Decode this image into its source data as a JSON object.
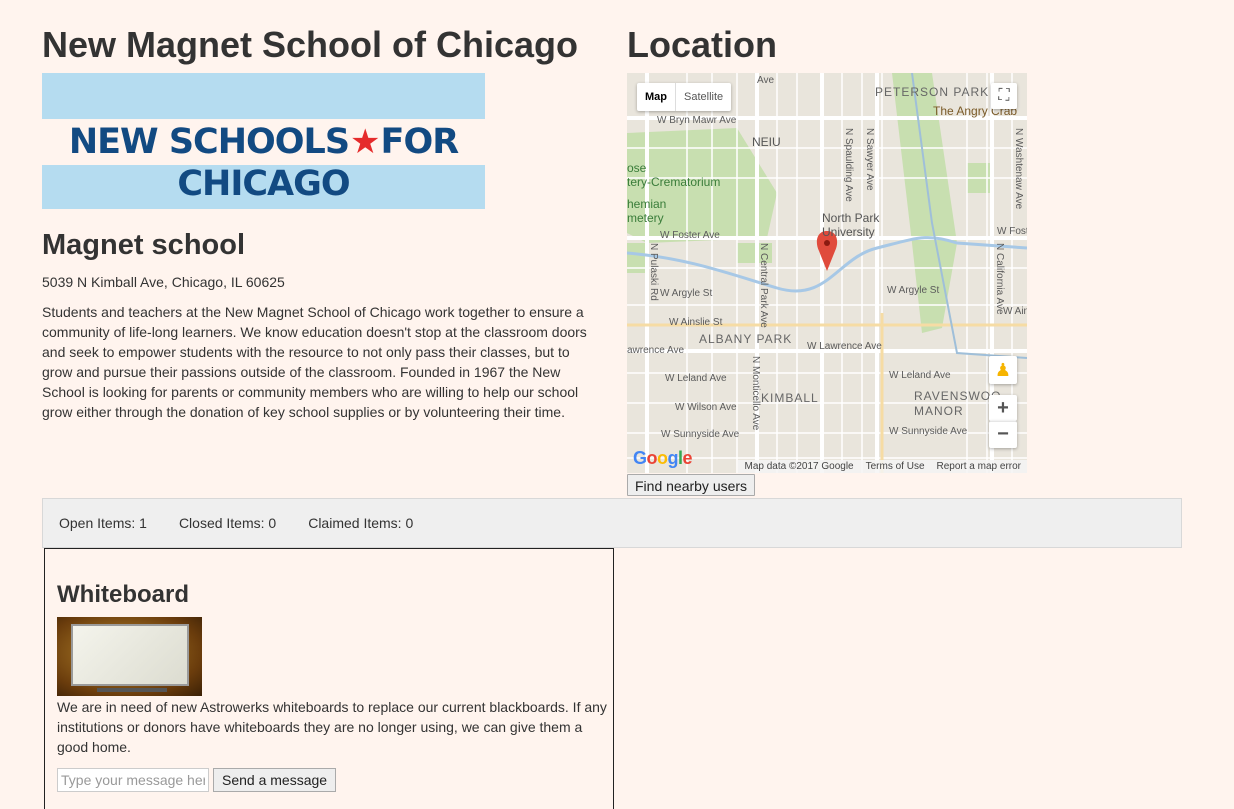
{
  "school": {
    "title": "New Magnet School of Chicago",
    "logo_text_left": "NEW SCHOOLS",
    "logo_text_right": "FOR CHICAGO",
    "type": "Magnet school",
    "address": "5039 N Kimball Ave, Chicago, IL 60625",
    "description": "Students and teachers at the New Magnet School of Chicago work together to ensure a community of life-long learners. We know education doesn't stop at the classroom doors and seek to empower students with the resource to not only pass their classes, but to grow and pursue their passions outside of the classroom. Founded in 1967 the New School is looking for parents or community members who are willing to help our school grow either through the donation of key school supplies or by volunteering their time."
  },
  "location": {
    "title": "Location",
    "map": {
      "type_map": "Map",
      "type_satellite": "Satellite",
      "google": "Google",
      "attribution": "Map data ©2017 Google",
      "terms": "Terms of Use",
      "report": "Report a map error",
      "labels": {
        "peterson_park": "PETERSON PARK",
        "angry_crab": "The Angry Crab",
        "bryn_mawr": "W Bryn Mawr Ave",
        "neiu": "NEIU",
        "crematorium": "tery-Crematorium",
        "rose": "ose",
        "hemian": "hemian",
        "metery": "metery",
        "north_park": "North Park",
        "university": "University",
        "foster_left": "W Foster Ave",
        "foster_right": "W Fost",
        "argyle_left": "W Argyle St",
        "argyle_right": "W Argyle St",
        "ainslie": "W Ainslie St",
        "albany_park": "ALBANY PARK",
        "lawrence_left": "awrence Ave",
        "lawrence_mid": "W Lawrence Ave",
        "leland_left": "W Leland Ave",
        "leland_right": "W Leland Ave",
        "wilson": "W Wilson Ave",
        "kimball": "KIMBALL",
        "ravenswood": "RAVENSWOO",
        "manor": "MANOR",
        "sunnyside_left": "W Sunnyside Ave",
        "sunnyside_right": "W Sunnyside Ave",
        "pulaski": "N Pulaski Rd",
        "central_park": "N Central Park Ave",
        "monticello": "N Monticello Ave",
        "spaulding": "N Spaulding Ave",
        "sawyer": "N Sawyer Ave",
        "california": "N California Ave",
        "washtenaw": "N Washtenaw Ave",
        "w_ain": "W Ain",
        "ave_top": "Ave"
      }
    },
    "find_button": "Find nearby users"
  },
  "stats": {
    "open": "Open Items: 1",
    "closed": "Closed Items: 0",
    "claimed": "Claimed Items: 0"
  },
  "item": {
    "title": "Whiteboard",
    "description": "We are in need of new Astrowerks whiteboards to replace our current blackboards. If any institutions or donors have whiteboards they are no longer using, we can give them a good home.",
    "message_placeholder": "Type your message here",
    "send_label": "Send a message"
  },
  "colors": {
    "background": "#fff4ee",
    "logo_blue": "#124a82",
    "logo_star": "#e52b2b",
    "logo_band": "#b5dcf0",
    "map_marker": "#e04b3c"
  }
}
